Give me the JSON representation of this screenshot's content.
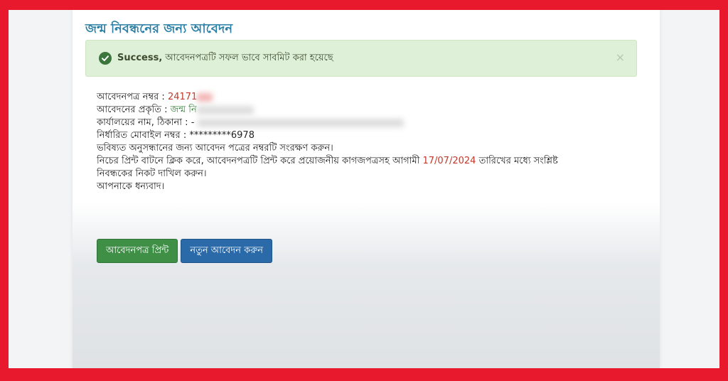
{
  "page": {
    "title": "জন্ম নিবন্ধনের জন্য আবেদন"
  },
  "alert": {
    "status_word": "Success,",
    "message": " আবেদনপত্রটি সফল ভাবে সাবমিট করা হয়েছে",
    "close_glyph": "×",
    "check_glyph": "✓"
  },
  "info": {
    "application_no_label": "আবেদনপত্র নম্বর :",
    "application_no_value": "24171",
    "application_type_label": "আবেদনের প্রকৃতি :",
    "application_type_value": "জন্ম নি",
    "office_label": "কার্যালয়ের নাম, ঠিকানা :",
    "office_value": "-",
    "mobile_label": "নির্ধারিত মোবাইল নম্বর :",
    "mobile_value": "*********6978",
    "line_save": "ভবিষ্যত অনুসন্ধানের জন্য আবেদন পত্রের নম্বরটি সংরক্ষণ করুন।",
    "line_print_before": "নিচের প্রিন্ট বাটনে ক্লিক করে, আবেদনপত্রটি প্রিন্ট করে প্রয়োজনীয় কাগজপত্রসহ আগামী",
    "deadline_date": "17/07/2024",
    "line_print_after": "তারিখের মধ্যে সংশ্লিষ্ট",
    "line_submit": "নিবন্ধকের নিকট দাখিল করুন।",
    "line_thanks": "আপনাকে ধন্যবাদ।"
  },
  "buttons": {
    "print_label": "আবেদনপত্র প্রিন্ট",
    "new_label": "নতুন আবেদন করুন"
  },
  "colors": {
    "frame": "#e8192c",
    "title": "#2a7fa6",
    "alert_bg": "#dff0d8",
    "print_button": "#3f8f47",
    "new_button": "#2b6aa8",
    "highlight_red": "#c0392b"
  }
}
